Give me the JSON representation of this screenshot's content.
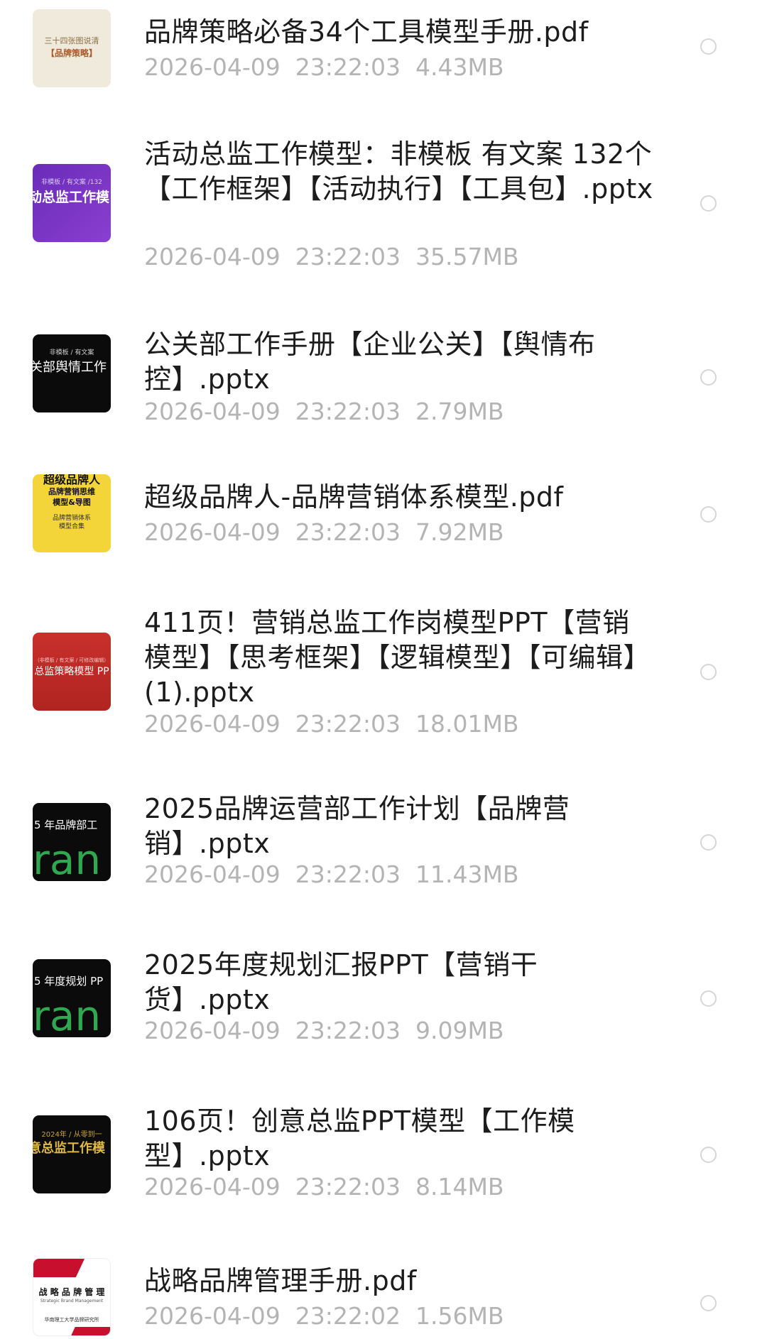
{
  "files": [
    {
      "name": "品牌策略必备34个工具模型手册.pdf",
      "date": "2026-04-09",
      "time": "23:22:03",
      "size": "4.43MB",
      "thumb": {
        "lines": [
          "三十四张图说清",
          "【品牌策略】"
        ]
      }
    },
    {
      "name": "活动总监工作模型：非模板 有文案 132个【工作框架】【活动执行】【工具包】.pptx",
      "date": "2026-04-09",
      "time": "23:22:03",
      "size": "35.57MB",
      "thumb": {
        "lines": [
          "非模板 / 有文案 /132",
          "动总监工作模"
        ]
      }
    },
    {
      "name": "公关部工作手册【企业公关】【舆情布控】.pptx",
      "date": "2026-04-09",
      "time": "23:22:03",
      "size": "2.79MB",
      "thumb": {
        "lines": [
          "非模板 / 有文案",
          "关部舆情工作"
        ]
      }
    },
    {
      "name": "超级品牌人-品牌营销体系模型.pdf",
      "date": "2026-04-09",
      "time": "23:22:03",
      "size": "7.92MB",
      "thumb": {
        "lines": [
          "超级品牌人",
          "品牌营销思维",
          "模型&导图",
          "品牌营销体系",
          "模型合集"
        ]
      }
    },
    {
      "name": "411页！营销总监工作岗模型PPT【营销模型】【思考框架】【逻辑模型】【可编辑】(1).pptx",
      "date": "2026-04-09",
      "time": "23:22:03",
      "size": "18.01MB",
      "thumb": {
        "lines": [
          "（非模板 / 有文案 / 可修改编辑）",
          "总监策略模型 PP"
        ]
      }
    },
    {
      "name": "2025品牌运营部工作计划【品牌营销】.pptx",
      "date": "2026-04-09",
      "time": "23:22:03",
      "size": "11.43MB",
      "thumb": {
        "lines": [
          "5 年品牌部工",
          "ran"
        ]
      }
    },
    {
      "name": "2025年度规划汇报PPT【营销干货】.pptx",
      "date": "2026-04-09",
      "time": "23:22:03",
      "size": "9.09MB",
      "thumb": {
        "lines": [
          "5 年度规划 PP",
          "ran"
        ]
      }
    },
    {
      "name": "106页！创意总监PPT模型【工作模型】.pptx",
      "date": "2026-04-09",
      "time": "23:22:03",
      "size": "8.14MB",
      "thumb": {
        "lines": [
          "2024年 / 从零到一",
          "意总监工作模"
        ]
      }
    },
    {
      "name": "战略品牌管理手册.pdf",
      "date": "2026-04-09",
      "time": "23:22:02",
      "size": "1.56MB",
      "thumb": {
        "lines": [
          "战 略 品 牌 管 理",
          "Strategic Brand Management",
          "华南理工大学品牌研究所"
        ]
      }
    }
  ]
}
